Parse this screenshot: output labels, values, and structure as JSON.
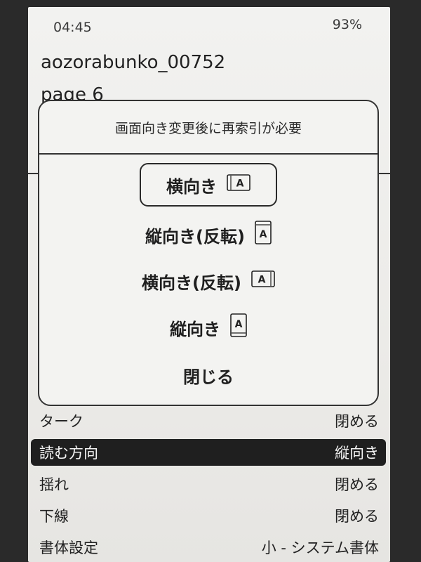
{
  "status": {
    "time": "04:45",
    "battery": "93%"
  },
  "document": {
    "title": "aozorabunko_00752",
    "page": "page 6"
  },
  "dialog": {
    "title": "画面向き変更後に再索引が必要",
    "options": [
      {
        "label": "横向き",
        "icon": "landscape-icon"
      },
      {
        "label": "縦向き(反転)",
        "icon": "portrait-inverted-icon"
      },
      {
        "label": "横向き(反転)",
        "icon": "landscape-inverted-icon"
      },
      {
        "label": "縦向き",
        "icon": "portrait-icon"
      }
    ],
    "close_label": "閉じる"
  },
  "menu": {
    "items": [
      {
        "label": "ターク",
        "value": "閉める"
      },
      {
        "label": "読む方向",
        "value": "縦向き"
      },
      {
        "label": "揺れ",
        "value": "閉める"
      },
      {
        "label": "下線",
        "value": "閉める"
      },
      {
        "label": "書体設定",
        "value": "小 - システム書体"
      }
    ]
  }
}
